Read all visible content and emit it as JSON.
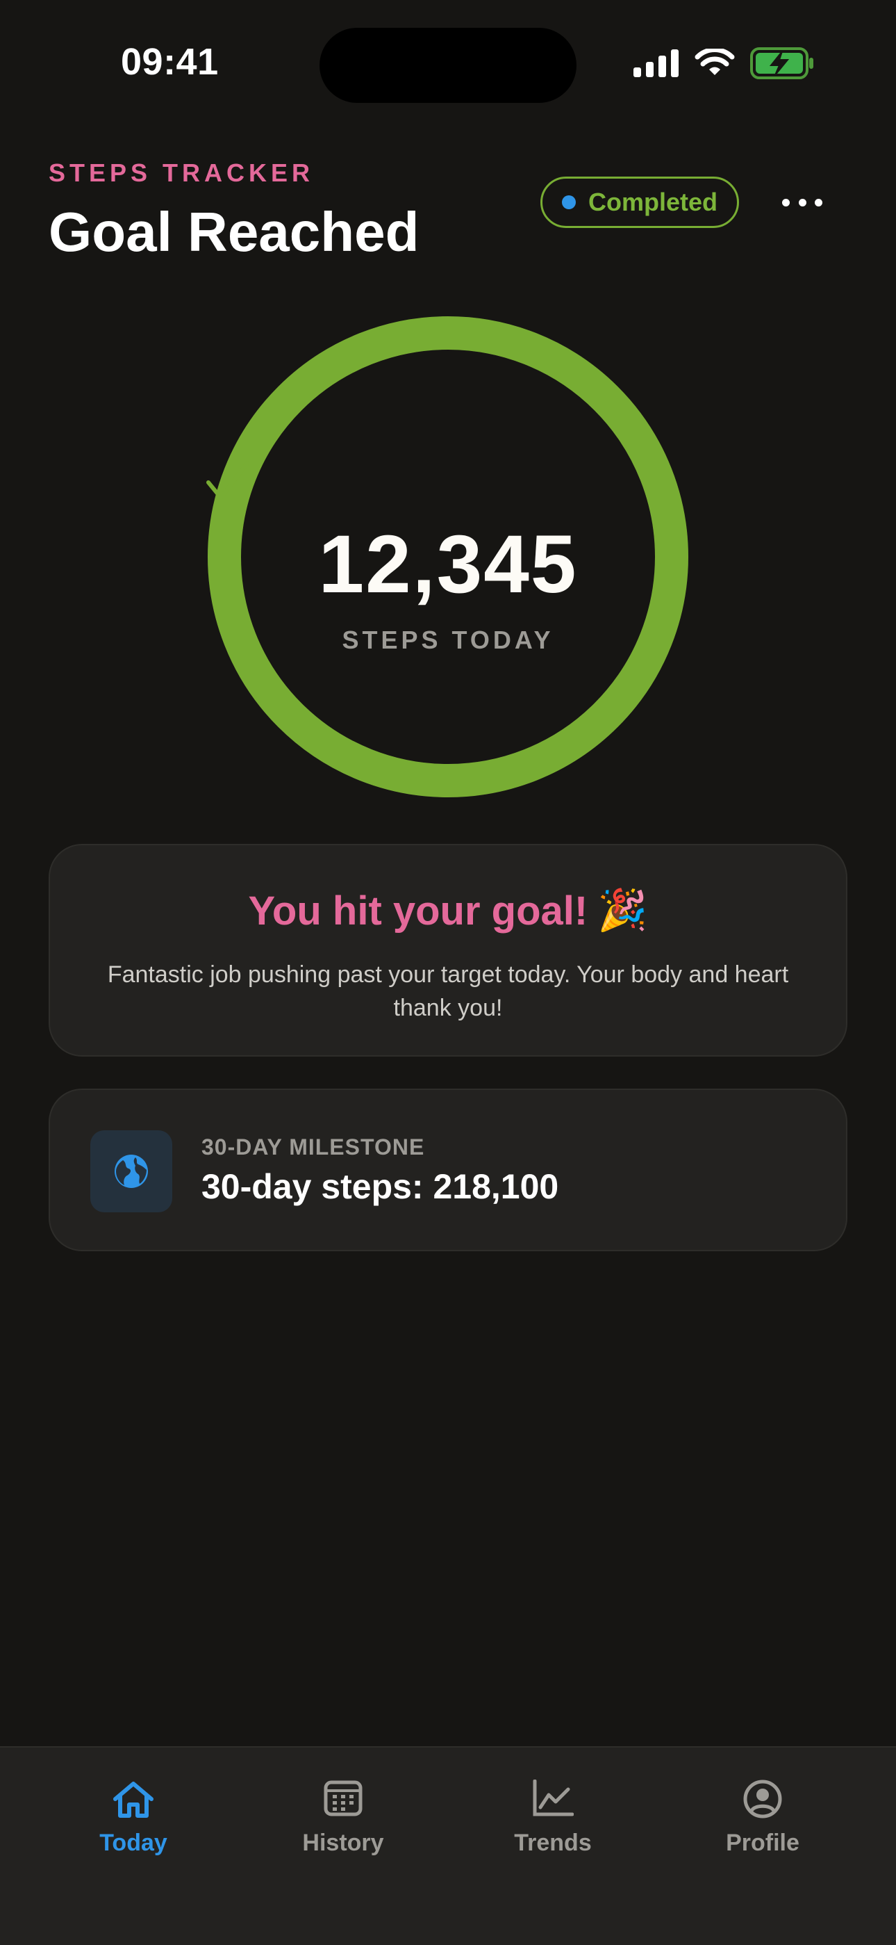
{
  "status_bar": {
    "time": "09:41"
  },
  "header": {
    "eyebrow": "STEPS TRACKER",
    "title": "Goal Reached",
    "status_pill": "Completed"
  },
  "progress": {
    "value": "12,345",
    "label": "STEPS TODAY",
    "fraction_complete": 1.0
  },
  "goal_card": {
    "title": "You hit your goal!",
    "emoji": "🎉",
    "message": "Fantastic job pushing past your target today. Your body and heart thank you!"
  },
  "milestone_card": {
    "eyebrow": "30-DAY MILESTONE",
    "value": "30-day steps: 218,100",
    "icon": "globe-icon"
  },
  "tabbar": {
    "items": [
      {
        "label": "Today",
        "icon": "home-icon",
        "active": true
      },
      {
        "label": "History",
        "icon": "calendar-icon",
        "active": false
      },
      {
        "label": "Trends",
        "icon": "chart-icon",
        "active": false
      },
      {
        "label": "Profile",
        "icon": "user-icon",
        "active": false
      }
    ]
  },
  "colors": {
    "background": "#161513",
    "accent_pink": "#e4699a",
    "ring_green": "#78ad33",
    "active_blue": "#2f95e8",
    "card": "#232220"
  }
}
